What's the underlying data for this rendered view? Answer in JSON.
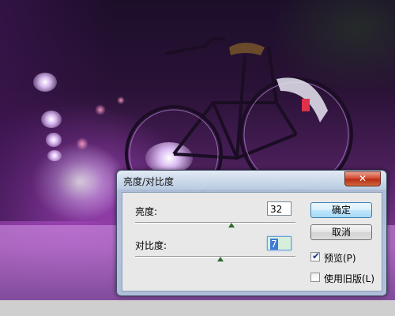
{
  "dialog": {
    "title": "亮度/对比度",
    "close_icon": "close-icon",
    "brightness": {
      "label": "亮度:",
      "value": "32",
      "slider_fraction": 0.6
    },
    "contrast": {
      "label": "对比度:",
      "value": "7",
      "slider_fraction": 0.53
    },
    "buttons": {
      "ok": "确定",
      "cancel": "取消"
    },
    "checkboxes": {
      "preview": {
        "label": "预览(P)",
        "checked": true
      },
      "legacy": {
        "label": "使用旧版(L)",
        "checked": false
      }
    }
  },
  "colors": {
    "close_button": "#d2452c",
    "slider_thumb": "#2e6b2e",
    "default_button_border": "#3c7fb1"
  }
}
